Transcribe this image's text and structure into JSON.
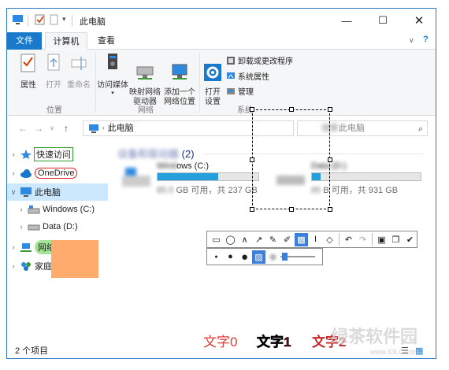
{
  "window": {
    "title": "此电脑"
  },
  "ribbon": {
    "tabs": [
      "文件",
      "计算机",
      "查看"
    ],
    "location_group": {
      "label": "位置",
      "items": [
        "属性",
        "打开",
        "重命名"
      ]
    },
    "network_group": {
      "label": "网络",
      "items": [
        "访问媒体",
        "映射网络\n驱动器",
        "添加一个\n网络位置"
      ]
    },
    "system_group": {
      "label": "系统",
      "open_settings": "打开\n设置",
      "small_items": [
        "卸载或更改程序",
        "系统属性",
        "管理"
      ]
    }
  },
  "address": {
    "path": "此电脑",
    "search_placeholder": "此电脑"
  },
  "nav": {
    "items": [
      {
        "label": "快速访问",
        "icon": "star-icon"
      },
      {
        "label": "OneDrive",
        "icon": "cloud-icon"
      },
      {
        "label": "此电脑",
        "icon": "computer-icon"
      },
      {
        "label": "Windows (C:)",
        "icon": "drive-icon"
      },
      {
        "label": "Data (D:)",
        "icon": "drive-icon"
      },
      {
        "label": "网络",
        "icon": "network-icon"
      },
      {
        "label": "家庭组",
        "icon": "homegroup-icon"
      }
    ]
  },
  "content": {
    "section_title": "(2)",
    "drives": [
      {
        "name": "ows (C:)",
        "free_text": "GB 可用，共 237 GB",
        "used_fraction": 0.6
      },
      {
        "name": "",
        "free_text": "B 可用，共 931 GB",
        "used_fraction": 0.08
      }
    ]
  },
  "status": {
    "item_count": "2 个项目"
  },
  "annotations": [
    {
      "text": "文字0",
      "color": "#e53935"
    },
    {
      "text": "文字1",
      "color": "#6d1010"
    },
    {
      "text": "文字2",
      "color": "#c62828"
    }
  ],
  "watermark": {
    "text": "绿茶软件园",
    "sub": "www.33LC.com"
  },
  "colors": {
    "accent": "#1979ca",
    "selected": "#cce8ff",
    "bar": "#26a0da"
  }
}
